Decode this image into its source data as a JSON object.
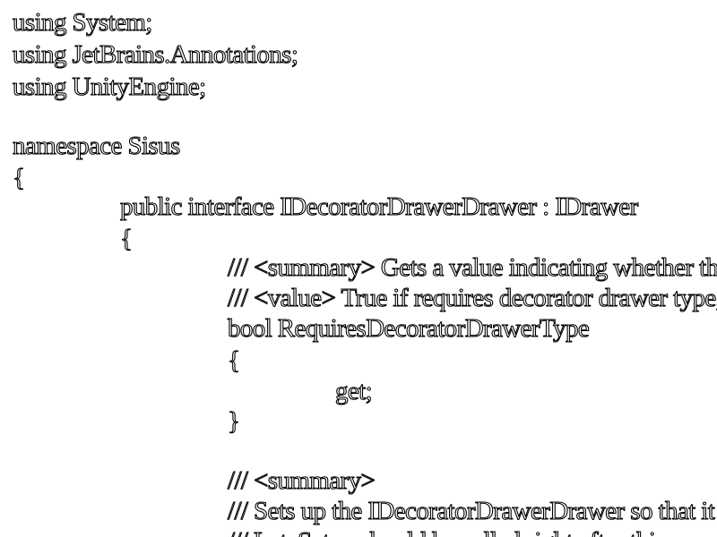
{
  "code": {
    "lines": [
      "using System;",
      "using JetBrains.Annotations;",
      "using UnityEngine;",
      "",
      "namespace Sisus",
      "{",
      "public interface IDecoratorDrawerDrawer : IDrawer",
      "{",
      "/// <summary> Gets a value indicating whether this object requires decorator drawer type. </summary>",
      "/// <value> True if requires decorator drawer type, false if not. </value>",
      "bool RequiresDecoratorDrawerType",
      "{",
      "get;",
      "}",
      "",
      "/// <summary>",
      "/// Sets up the IDecoratorDrawerDrawer so that it is ready to be used.",
      "/// LateSetup should be called right after this."
    ]
  }
}
